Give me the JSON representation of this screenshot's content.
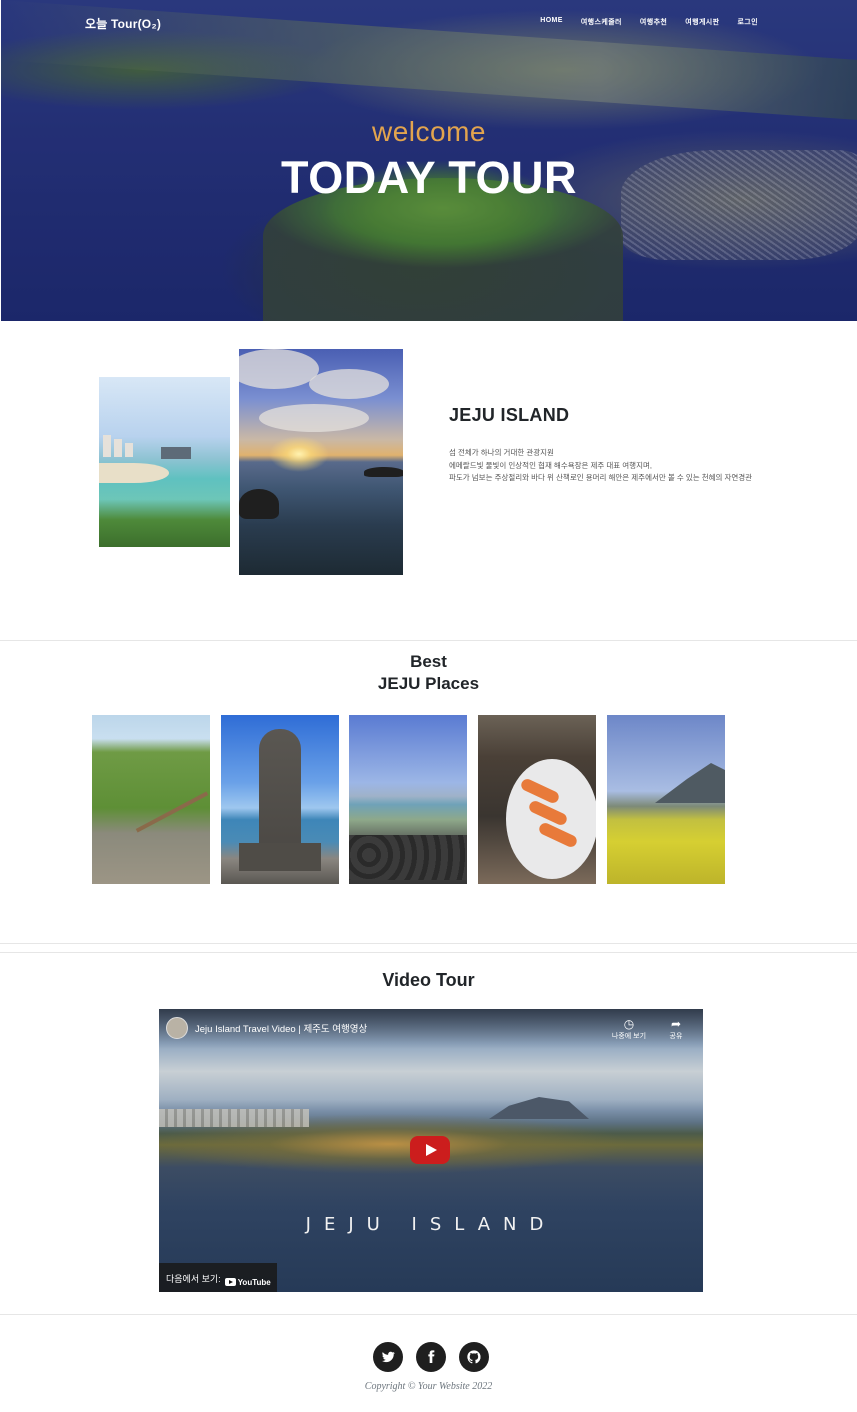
{
  "header": {
    "brand": "오늘 Tour(O₂)",
    "nav": [
      "HOME",
      "여행스케줄러",
      "여행추천",
      "여행게시판",
      "로그인"
    ]
  },
  "hero": {
    "subtitle": "welcome",
    "title": "TODAY TOUR"
  },
  "about": {
    "title": "JEJU ISLAND",
    "lines": [
      "섬 전체가 하나의 거대한 관광지원",
      "에메랄드빛 물빛이 인상적인 협재 해수욕장은 제주 대표 여행지며,",
      "파도가 넘보는 주상절리와 바다 위 산책로인 용머리 해안은 제주에서만 볼 수 있는 천혜의 자연경관"
    ]
  },
  "best": {
    "title_line1": "Best",
    "title_line2": "JEJU Places"
  },
  "video": {
    "section_title": "Video Tour",
    "player_title": "Jeju Island Travel Video | 제주도 여행영상",
    "watch_later": "나중에 보기",
    "share": "공유",
    "overlay_text": "JEJU ISLAND",
    "watch_on": "다음에서 보기:",
    "youtube": "YouTube",
    "accent_color": "#cc1d1d"
  },
  "footer": {
    "icons": [
      "twitter-icon",
      "facebook-icon",
      "github-icon"
    ],
    "copyright": "Copyright © Your Website 2022"
  }
}
